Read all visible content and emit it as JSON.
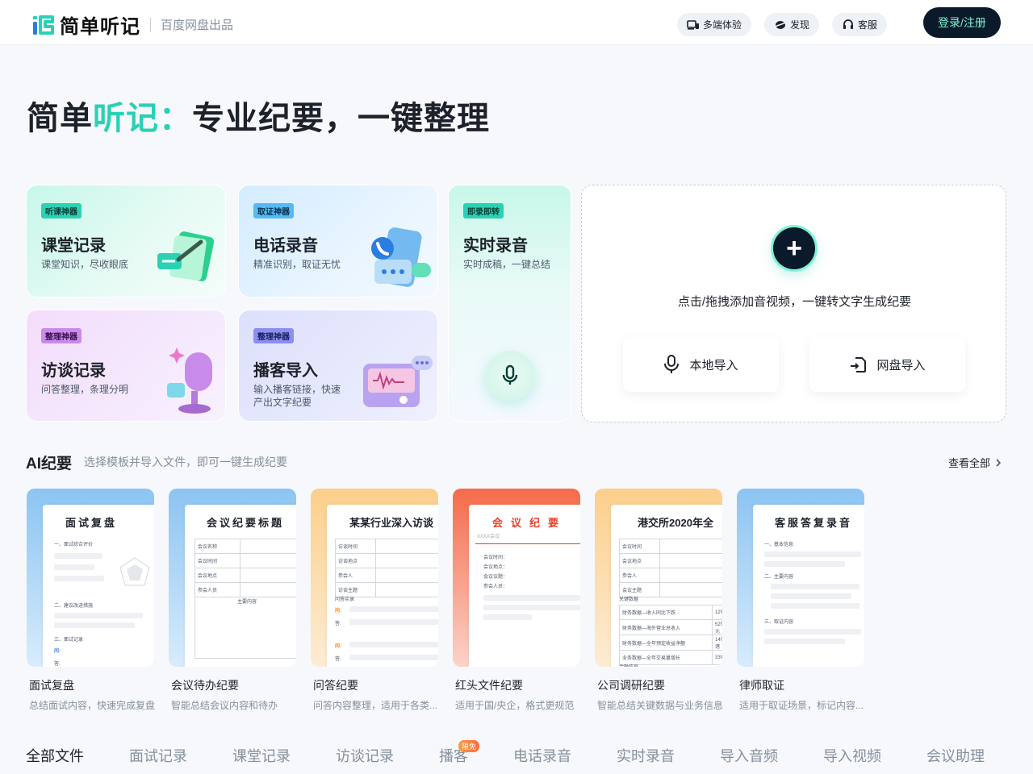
{
  "header": {
    "logo_text": "简单听记",
    "logo_sub": "百度网盘出品",
    "nav": [
      {
        "label": "多端体验",
        "icon": "devices-icon"
      },
      {
        "label": "发现",
        "icon": "discover-icon"
      },
      {
        "label": "客服",
        "icon": "headset-icon"
      }
    ],
    "login_label": "登录/注册"
  },
  "hero": {
    "brand_a": "简单",
    "brand_b": "听记：",
    "slogan": "专业纪要，一键整理"
  },
  "cards": [
    {
      "tag": "听课神器",
      "title": "课堂记录",
      "desc": "课堂知识，尽收眼底"
    },
    {
      "tag": "取证神器",
      "title": "电话录音",
      "desc": "精准识别，取证无忧"
    },
    {
      "tag": "即录即转",
      "title": "实时录音",
      "desc": "实时成稿，一键总结"
    },
    {
      "tag": "整理神器",
      "title": "访谈记录",
      "desc": "问答整理，条理分明"
    },
    {
      "tag": "整理神器",
      "title": "播客导入",
      "desc": "输入播客链接，快速产出文字纪要"
    }
  ],
  "upload": {
    "hint": "点击/拖拽添加音视频，一键转文字生成纪要",
    "local_label": "本地导入",
    "cloud_label": "网盘导入"
  },
  "ai_section": {
    "title": "AI纪要",
    "subtitle": "选择模板并导入文件，即可一键生成纪要",
    "see_all": "查看全部"
  },
  "templates": [
    {
      "name": "面试复盘",
      "desc": "总结面试内容，快速完成复盘",
      "doc_title": "面试复盘"
    },
    {
      "name": "会议待办纪要",
      "desc": "智能总结会议内容和待办",
      "doc_title": "会议纪要标题"
    },
    {
      "name": "问答纪要",
      "desc": "问答内容整理，适用于各类...",
      "doc_title": "某某行业深入访谈"
    },
    {
      "name": "红头文件纪要",
      "desc": "适用于国/央企，格式更规范",
      "doc_title": "会议纪要"
    },
    {
      "name": "公司调研纪要",
      "desc": "智能总结关键数据与业务信息",
      "doc_title": "港交所2020年全"
    },
    {
      "name": "律师取证",
      "desc": "适用于取证场景，标记内容...",
      "doc_title": "客服答复录音"
    }
  ],
  "tabs": [
    "全部文件",
    "面试记录",
    "课堂记录",
    "访谈记录",
    "播客",
    "电话录音",
    "实时录音",
    "导入音频",
    "导入视频",
    "会议助理"
  ],
  "tab_badge": "限免"
}
